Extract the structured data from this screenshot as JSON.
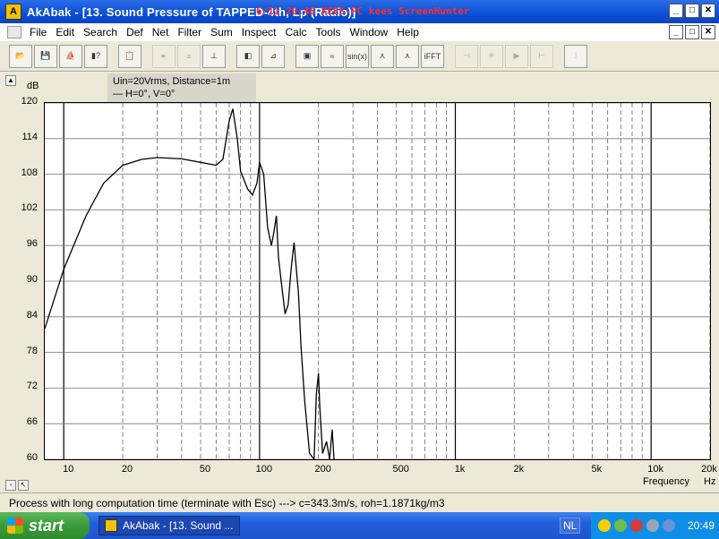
{
  "window": {
    "title": "AkAbak - [13. Sound Pressure of TAPPED-4th, Lp (Radio)]",
    "watermark": "6/11 20:48 KEES-PC kees ScreenHunter",
    "min": "_",
    "max": "□",
    "close": "✕"
  },
  "menu": [
    "File",
    "Edit",
    "Search",
    "Def",
    "Net",
    "Filter",
    "Sum",
    "Inspect",
    "Calc",
    "Tools",
    "Window",
    "Help"
  ],
  "toolbar": {
    "buttons": [
      {
        "name": "open-icon",
        "label": "📂",
        "enabled": true
      },
      {
        "name": "save-icon",
        "label": "💾",
        "enabled": true
      },
      {
        "name": "network-icon",
        "label": "⛵",
        "enabled": true
      },
      {
        "name": "script-icon",
        "label": "▮?",
        "enabled": true
      },
      {
        "name": "clipboard-icon",
        "label": "📋",
        "enabled": true
      },
      {
        "name": "pointer-icon",
        "label": "▸",
        "enabled": false
      },
      {
        "name": "list-icon",
        "label": "≡",
        "enabled": false
      },
      {
        "name": "range-icon",
        "label": "⊥",
        "enabled": true
      },
      {
        "name": "speaker-icon",
        "label": "◧",
        "enabled": true
      },
      {
        "name": "axes-icon",
        "label": "⊿",
        "enabled": true
      },
      {
        "name": "driver-icon",
        "label": "▣",
        "enabled": true
      },
      {
        "name": "filter-icon",
        "label": "≈",
        "enabled": true
      },
      {
        "name": "sine-icon",
        "label": "sin(x)",
        "enabled": true
      },
      {
        "name": "curve-icon",
        "label": "⋏",
        "enabled": true
      },
      {
        "name": "curve-edit-icon",
        "label": "⋏",
        "enabled": true
      },
      {
        "name": "ifft-icon",
        "label": "iFFT",
        "enabled": true
      },
      {
        "name": "step-back-icon",
        "label": "⊣",
        "enabled": false
      },
      {
        "name": "star-icon",
        "label": "✳",
        "enabled": false
      },
      {
        "name": "play-icon",
        "label": "▶",
        "enabled": false
      },
      {
        "name": "step-fwd-icon",
        "label": "⊢",
        "enabled": false
      },
      {
        "name": "graph-icon",
        "label": "⫶",
        "enabled": true
      }
    ]
  },
  "legend": {
    "line1": "Uin=20Vrms, Distance=1m",
    "line2": "— H=0°, V=0°"
  },
  "chart_data": {
    "type": "line",
    "ylabel": "dB",
    "xlabel": "Frequency",
    "xunit": "Hz",
    "xscale": "log",
    "xlim": [
      8,
      20000
    ],
    "ylim": [
      60,
      120
    ],
    "grid": true,
    "yticks": [
      120,
      114,
      108,
      102,
      96,
      90,
      84,
      78,
      72,
      66,
      60
    ],
    "xticks": [
      {
        "v": 10,
        "label": "10"
      },
      {
        "v": 20,
        "label": "20"
      },
      {
        "v": 50,
        "label": "50"
      },
      {
        "v": 100,
        "label": "100"
      },
      {
        "v": 200,
        "label": "200"
      },
      {
        "v": 500,
        "label": "500"
      },
      {
        "v": 1000,
        "label": "1k"
      },
      {
        "v": 2000,
        "label": "2k"
      },
      {
        "v": 5000,
        "label": "5k"
      },
      {
        "v": 10000,
        "label": "10k"
      },
      {
        "v": 20000,
        "label": "20k"
      }
    ],
    "series": [
      {
        "x": [
          8,
          10,
          13,
          16,
          20,
          25,
          30,
          40,
          50,
          60,
          65,
          70,
          73,
          77,
          80,
          87,
          92,
          97,
          100,
          105,
          110,
          115,
          118,
          122,
          125,
          130,
          135,
          140,
          145,
          150,
          158,
          163,
          170,
          180,
          190,
          195,
          200,
          203,
          210,
          220,
          228,
          235,
          240
        ],
        "y": [
          82,
          92,
          101,
          106.5,
          109.5,
          110.5,
          110.8,
          110.6,
          110,
          109.5,
          110.5,
          117,
          119,
          114,
          108.5,
          105.5,
          104.5,
          106.5,
          110,
          108,
          99,
          96,
          98,
          101,
          94,
          89,
          84.5,
          86,
          92,
          96.5,
          88,
          79,
          70,
          61,
          60,
          71,
          74.5,
          69,
          61,
          63,
          60,
          65,
          60
        ]
      }
    ]
  },
  "status": "Process with long computation time (terminate with Esc) ---> c=343.3m/s, roh=1.1871kg/m3",
  "taskbar": {
    "start": "start",
    "task": "AkAbak - [13. Sound ...",
    "lang": "NL",
    "clock": "20:49"
  }
}
